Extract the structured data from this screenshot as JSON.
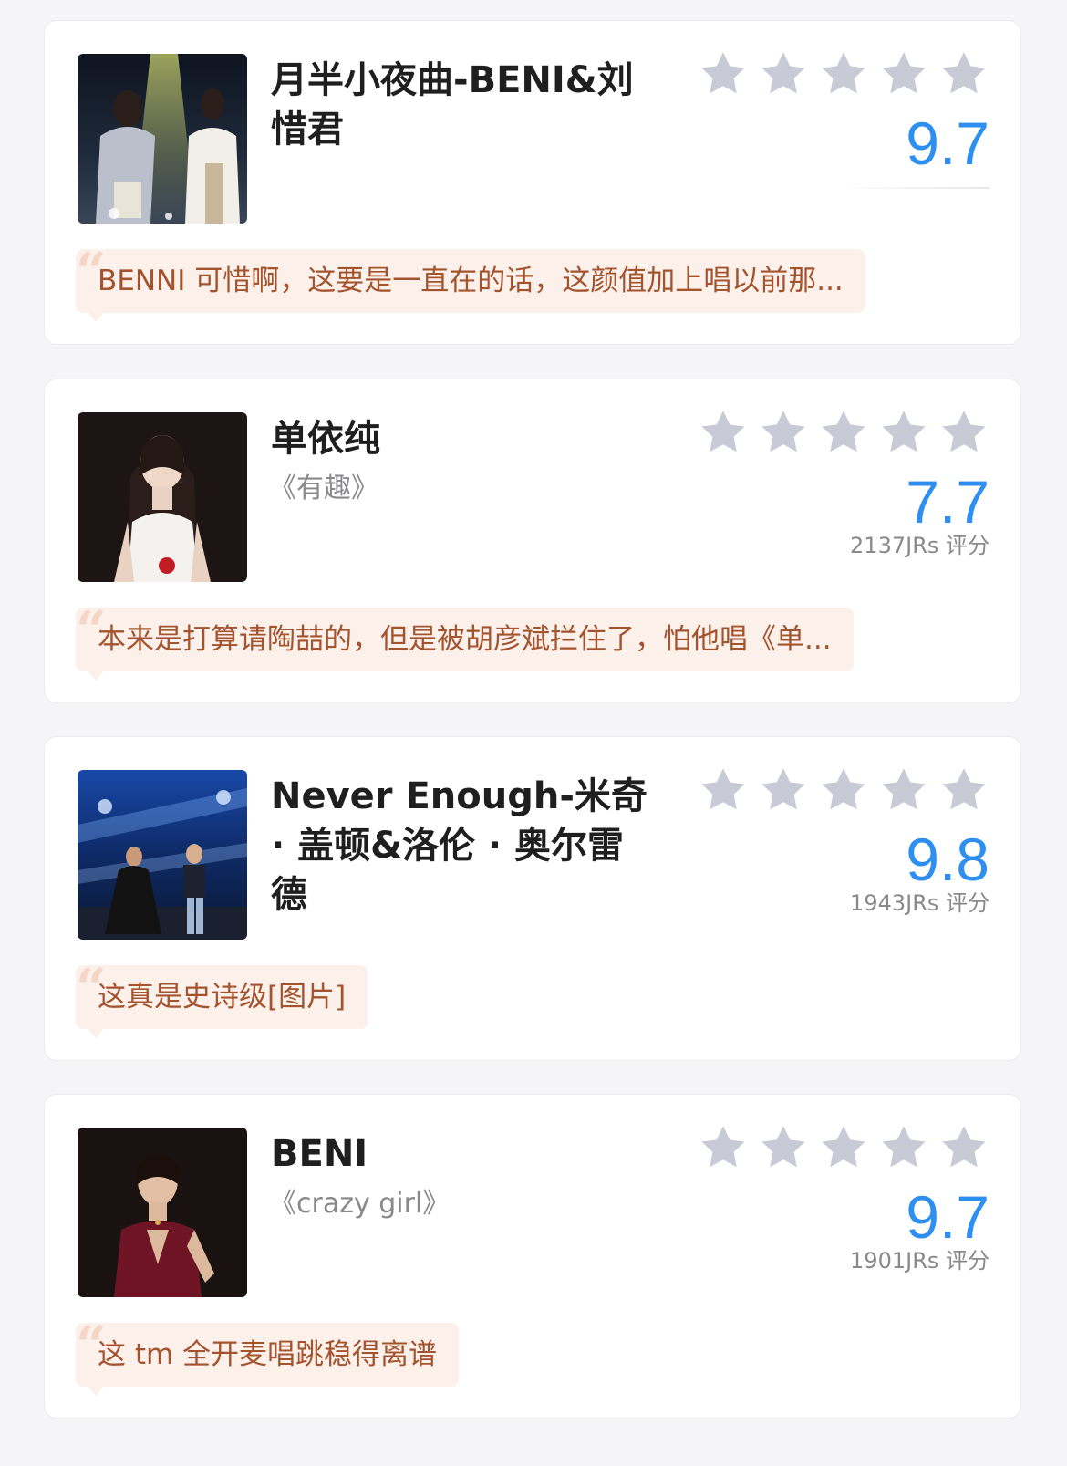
{
  "colors": {
    "accent": "#2d8ff0",
    "star": "#c8cad6",
    "comment_bg": "#fcf1ea",
    "comment_text": "#a4532f"
  },
  "cards": [
    {
      "title": "月半小夜曲-BENI&刘惜君",
      "subtitle": "",
      "score": "9.7",
      "votes": "",
      "stars": 5,
      "comment": "BENNI 可惜啊，这要是一直在的话，这颜值加上唱以前那..."
    },
    {
      "title": "单依纯",
      "subtitle": "《有趣》",
      "score": "7.7",
      "votes": "2137JRs 评分",
      "stars": 5,
      "comment": "本来是打算请陶喆的，但是被胡彦斌拦住了，怕他唱《单..."
    },
    {
      "title": "Never Enough-米奇 · 盖顿&洛伦 · 奥尔雷德",
      "subtitle": "",
      "score": "9.8",
      "votes": "1943JRs 评分",
      "stars": 5,
      "comment": "这真是史诗级[图片]"
    },
    {
      "title": "BENI",
      "subtitle": "《crazy girl》",
      "score": "9.7",
      "votes": "1901JRs 评分",
      "stars": 5,
      "comment": "这 tm 全开麦唱跳稳得离谱"
    }
  ]
}
